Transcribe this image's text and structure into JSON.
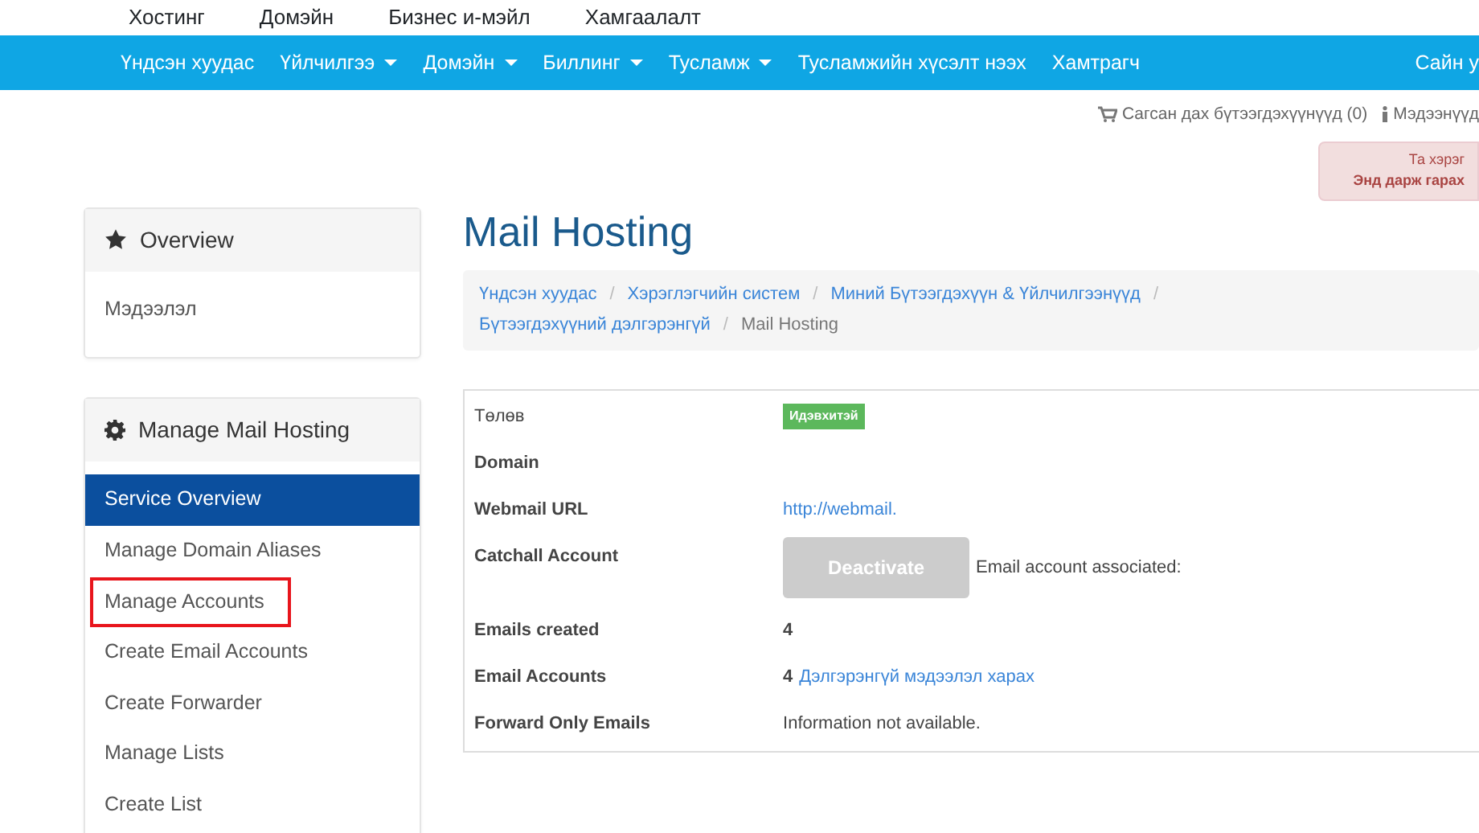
{
  "top_menu": [
    "Хостинг",
    "Домэйн",
    "Бизнес и-мэйл",
    "Хамгаалалт"
  ],
  "navbar": {
    "items": [
      {
        "label": "Үндсэн хуудас",
        "dropdown": false
      },
      {
        "label": "Үйлчилгээ",
        "dropdown": true
      },
      {
        "label": "Домэйн",
        "dropdown": true
      },
      {
        "label": "Биллинг",
        "dropdown": true
      },
      {
        "label": "Тусламж",
        "dropdown": true
      },
      {
        "label": "Тусламжийн хүсэлт нээх",
        "dropdown": false
      },
      {
        "label": "Хамтрагч",
        "dropdown": false
      }
    ],
    "greeting": "Сайн у"
  },
  "header_links": {
    "cart": "Сагсан дах бүтээгдэхүүнүүд (0)",
    "news": "Мэдээнүүд"
  },
  "alert": {
    "text": "Та хэрэг",
    "link": "Энд дарж гарах"
  },
  "sidebar": [
    {
      "title": "Overview",
      "items": [
        {
          "label": "Мэдээлэл",
          "selected": false,
          "highlighted": false
        }
      ]
    },
    {
      "title": "Manage Mail Hosting",
      "items": [
        {
          "label": "Service Overview",
          "selected": true,
          "highlighted": false
        },
        {
          "label": "Manage Domain Aliases",
          "selected": false,
          "highlighted": false
        },
        {
          "label": "Manage Accounts",
          "selected": false,
          "highlighted": true
        },
        {
          "label": "Create Email Accounts",
          "selected": false,
          "highlighted": false
        },
        {
          "label": "Create Forwarder",
          "selected": false,
          "highlighted": false
        },
        {
          "label": "Manage Lists",
          "selected": false,
          "highlighted": false
        },
        {
          "label": "Create List",
          "selected": false,
          "highlighted": false
        }
      ]
    }
  ],
  "page_title": "Mail Hosting",
  "breadcrumb": {
    "separator": "/",
    "items": [
      "Үндсэн хуудас",
      "Хэрэглэгчийн систем",
      "Миний Бүтээгдэхүүн & Үйлчилгээнүүд",
      "Бүтээгдэхүүний дэлгэрэнгүй",
      "Mail Hosting"
    ]
  },
  "details": [
    {
      "label": "Төлөв",
      "kind": "badge",
      "value": "Идэвхитэй"
    },
    {
      "label": "Domain",
      "kind": "text"
    },
    {
      "label": "Webmail URL",
      "kind": "link",
      "value": "http://webmail."
    },
    {
      "label": "Catchall Account",
      "kind": "button",
      "button": "Deactivate",
      "disabled": true,
      "value": "Email account associated:"
    },
    {
      "label": "Emails created",
      "kind": "count",
      "value": "4"
    },
    {
      "label": "Email Accounts",
      "kind": "count_link",
      "value": "4",
      "link": "Дэлгэрэнгүй мэдээлэл харах"
    },
    {
      "label": "Forward Only Emails",
      "kind": "text",
      "value": "Information not available."
    }
  ]
}
